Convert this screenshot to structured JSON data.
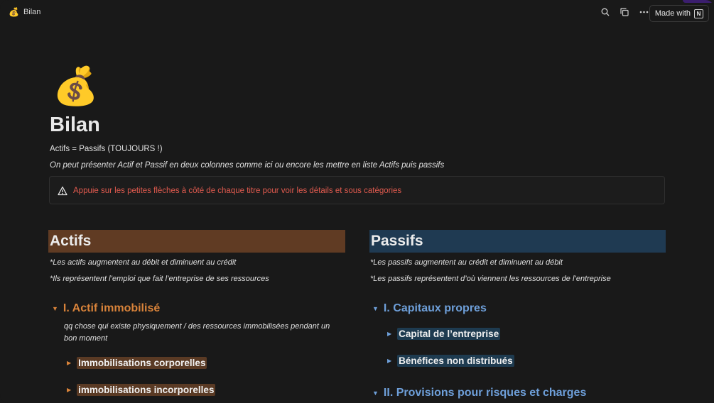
{
  "topbar": {
    "page_icon": "💰",
    "breadcrumb": "Bilan",
    "icons": [
      "search-icon",
      "duplicate-icon",
      "more-icon"
    ],
    "made_with_label": "Made with",
    "made_with_logo": "N"
  },
  "page": {
    "icon": "💰",
    "title": "Bilan",
    "line1": "Actifs = Passifs (TOUJOURS !)",
    "line2": "On peut présenter Actif et Passif en deux colonnes comme ici ou encore les mettre en liste Actifs puis passifs",
    "callout": {
      "icon": "warning-icon",
      "text": "Appuie sur les petites flèches à côté de chaque titre pour voir les détails et sous catégories",
      "color": "#e05a4e"
    }
  },
  "actifs": {
    "title": "Actifs",
    "title_bg": "#603b23",
    "notes": [
      "*Les actifs augmentent au débit et diminuent au crédit",
      "*Ils représentent l’emploi que fait l’entreprise de ses ressources"
    ],
    "sections": [
      {
        "title": "I. Actif immobilisé",
        "description": "qq chose qui existe physiquement / des ressources immobilisées pendant un bon moment",
        "items": [
          "Immobilisations corporelles",
          "immobilisations incorporelles"
        ]
      }
    ]
  },
  "passifs": {
    "title": "Passifs",
    "title_bg": "#1f3a52",
    "notes": [
      "*Les passifs augmentent au crédit et diminuent au débit",
      "*Les passifs représentent d’où viennent les ressources de l’entreprise"
    ],
    "sections": [
      {
        "title": "I. Capitaux propres",
        "items": [
          "Capital de l’entreprise",
          "Bénéfices non distribués"
        ]
      },
      {
        "title": "II. Provisions pour risques et charges",
        "items": []
      }
    ]
  },
  "colors": {
    "background": "#191919",
    "orange_heading": "#d9833a",
    "blue_heading": "#6e9fd9"
  }
}
